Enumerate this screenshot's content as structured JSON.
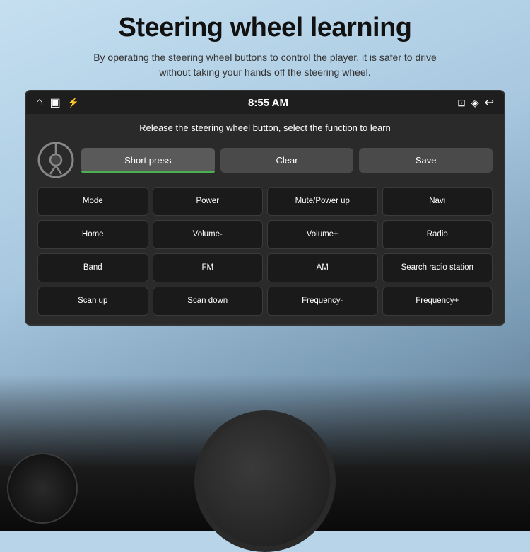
{
  "page": {
    "title": "Steering wheel learning",
    "subtitle": "By operating the steering wheel buttons to control the player, it is safer to drive without taking your hands off the steering wheel."
  },
  "statusBar": {
    "time": "8:55 AM",
    "icons": {
      "home": "⌂",
      "window": "▣",
      "usb": "⚡",
      "cast": "⊡",
      "location": "◈",
      "back": "↩"
    }
  },
  "panel": {
    "instruction": "Release the steering wheel button, select the function to learn",
    "buttons": {
      "shortPress": "Short press",
      "clear": "Clear",
      "save": "Save"
    },
    "grid": [
      {
        "label": "Mode"
      },
      {
        "label": "Power"
      },
      {
        "label": "Mute/Power up"
      },
      {
        "label": "Navi"
      },
      {
        "label": "Home"
      },
      {
        "label": "Volume-"
      },
      {
        "label": "Volume+"
      },
      {
        "label": "Radio"
      },
      {
        "label": "Band"
      },
      {
        "label": "FM"
      },
      {
        "label": "AM"
      },
      {
        "label": "Search radio station"
      },
      {
        "label": "Scan up"
      },
      {
        "label": "Scan down"
      },
      {
        "label": "Frequency-"
      },
      {
        "label": "Frequency+"
      }
    ]
  }
}
